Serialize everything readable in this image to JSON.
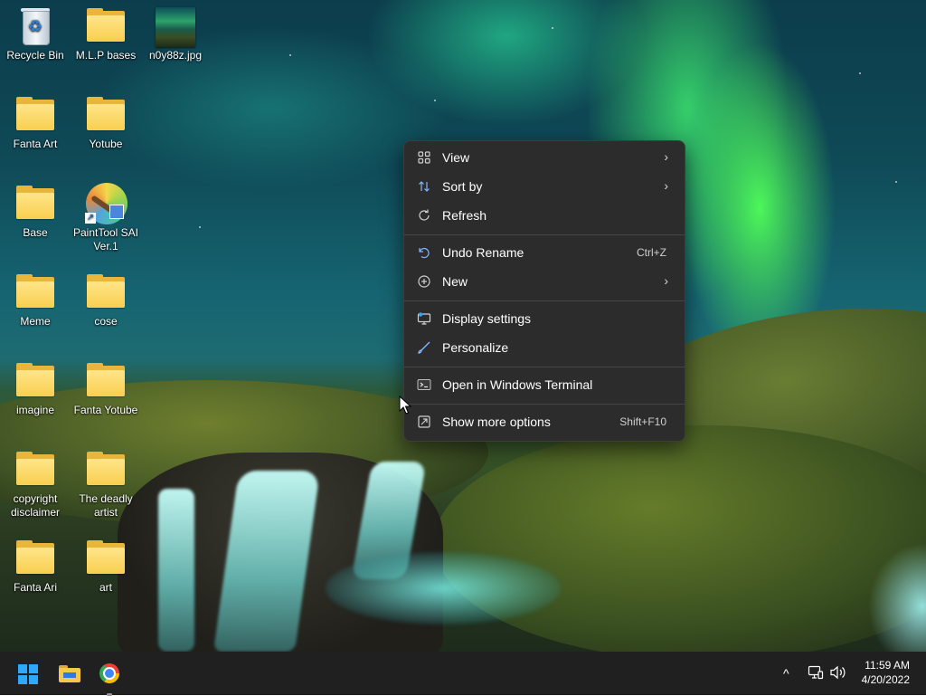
{
  "desktop": {
    "icons": [
      {
        "label": "Recycle Bin",
        "icon": "recycle-bin-icon"
      },
      {
        "label": "M.L.P bases",
        "icon": "folder-icon"
      },
      {
        "label": "n0y88z.jpg",
        "icon": "image-file-icon"
      },
      {
        "label": "Fanta Art",
        "icon": "folder-icon"
      },
      {
        "label": "Yotube",
        "icon": "folder-icon"
      },
      {
        "label": "Base",
        "icon": "folder-icon"
      },
      {
        "label": "PaintTool SAI Ver.1",
        "icon": "painttool-sai-icon"
      },
      {
        "label": "Meme",
        "icon": "folder-icon"
      },
      {
        "label": "cose",
        "icon": "folder-icon"
      },
      {
        "label": "imagine",
        "icon": "folder-icon"
      },
      {
        "label": "Fanta Yotube",
        "icon": "folder-icon"
      },
      {
        "label": "copyright disclaimer",
        "icon": "folder-icon"
      },
      {
        "label": "The deadly artist",
        "icon": "folder-icon"
      },
      {
        "label": "Fanta Ari",
        "icon": "folder-icon"
      },
      {
        "label": "art",
        "icon": "folder-icon"
      }
    ]
  },
  "context_menu": {
    "items": [
      {
        "label": "View",
        "icon": "grid-view-icon",
        "submenu": true
      },
      {
        "label": "Sort by",
        "icon": "sort-icon",
        "submenu": true
      },
      {
        "label": "Refresh",
        "icon": "refresh-icon"
      },
      {
        "label": "Undo Rename",
        "icon": "undo-icon",
        "shortcut": "Ctrl+Z"
      },
      {
        "label": "New",
        "icon": "plus-circle-icon",
        "submenu": true
      },
      {
        "label": "Display settings",
        "icon": "display-icon"
      },
      {
        "label": "Personalize",
        "icon": "brush-icon"
      },
      {
        "label": "Open in Windows Terminal",
        "icon": "terminal-icon"
      },
      {
        "label": "Show more options",
        "icon": "more-options-icon",
        "shortcut": "Shift+F10"
      }
    ]
  },
  "taskbar": {
    "pinned": [
      {
        "name": "Start",
        "icon": "windows-start-icon"
      },
      {
        "name": "File Explorer",
        "icon": "file-explorer-icon"
      },
      {
        "name": "Google Chrome",
        "icon": "chrome-icon"
      }
    ],
    "tray": {
      "overflow_glyph": "^",
      "network_icon": "network-icon",
      "volume_icon": "volume-icon"
    },
    "clock": {
      "time": "11:59 AM",
      "date": "4/20/2022"
    }
  },
  "colors": {
    "menu_bg": "#2c2c2c",
    "taskbar_bg": "#202020",
    "start_blue": "#2ea7ff",
    "folder_yellow": "#f8cf4e"
  }
}
